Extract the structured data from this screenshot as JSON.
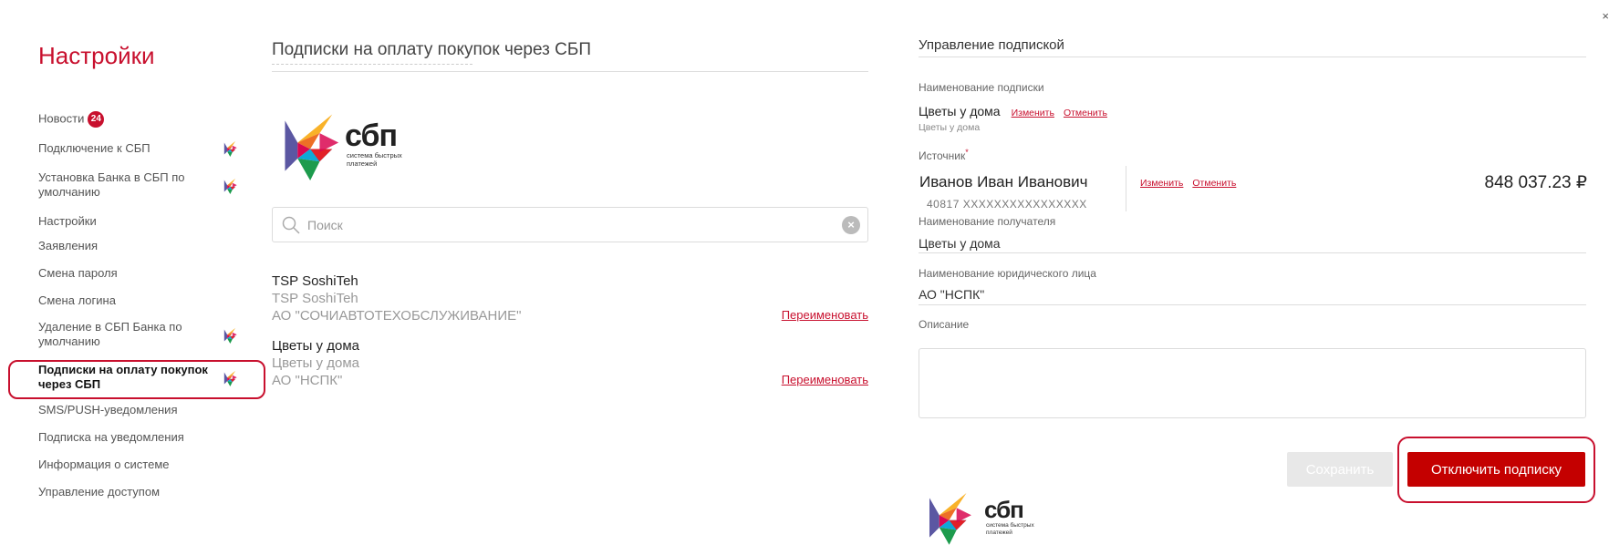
{
  "sidebar": {
    "title": "Настройки",
    "news_badge": "24",
    "items": [
      {
        "label": "Новости"
      },
      {
        "label": "Подключение к СБП"
      },
      {
        "label": "Установка Банка в СБП по умолчанию"
      },
      {
        "label": "Настройки"
      },
      {
        "label": "Заявления"
      },
      {
        "label": "Смена пароля"
      },
      {
        "label": "Смена логина"
      },
      {
        "label": "Удаление в СБП Банка по умолчанию"
      },
      {
        "label": "Подписки на оплату покупок через СБП"
      },
      {
        "label": "SMS/PUSH-уведомления"
      },
      {
        "label": "Подписка на уведомления"
      },
      {
        "label": "Информация о системе"
      },
      {
        "label": "Управление доступом"
      }
    ]
  },
  "main": {
    "title": "Подписки на оплату покупок через СБП",
    "logo": {
      "wordmark": "сбп",
      "tagline_1": "система быстрых",
      "tagline_2": "платежей"
    },
    "search_placeholder": "Поиск",
    "subscriptions": [
      {
        "name": "TSP SoshiTeh",
        "alias": "TSP SoshiTeh",
        "org": "АО \"СОЧИАВТОТЕХОБСЛУЖИВАНИЕ\"",
        "action": "Переименовать"
      },
      {
        "name": "Цветы у дома",
        "alias": "Цветы у дома",
        "org": "АО \"НСПК\"",
        "action": "Переименовать"
      }
    ]
  },
  "panel": {
    "title": "Управление подпиской",
    "sub_name_label": "Наименование подписки",
    "sub_name_value": "Цветы у дома",
    "sub_name_sub": "Цветы  у дома",
    "change_label": "Изменить",
    "cancel_label": "Отменить",
    "source_label": "Источник",
    "payer_name": "Иванов Иван Иванович",
    "account": "40817  XXXXXXXXXXXXXXXX",
    "balance": "848 037.23 ₽",
    "recipient_label": "Наименование получателя",
    "recipient_value": "Цветы  у дома",
    "legal_label": "Наименование юридического лица",
    "legal_value": "АО \"НСПК\"",
    "description_label": "Описание",
    "save_button": "Сохранить",
    "disable_button": "Отключить подписку",
    "corner_mark": "×"
  },
  "colors": {
    "accent": "#c8102e",
    "button_red": "#c40000",
    "disabled": "#e8e8e8"
  }
}
